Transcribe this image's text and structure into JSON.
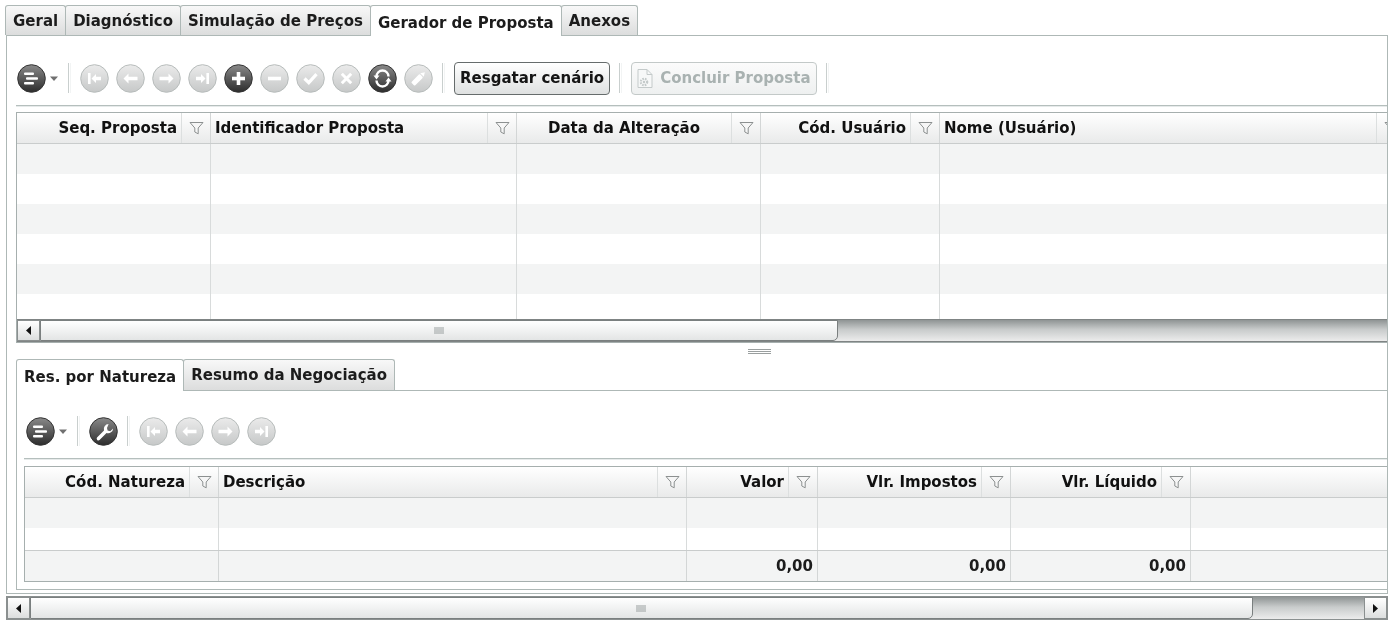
{
  "tabs": [
    {
      "label": "Geral",
      "selected": false
    },
    {
      "label": "Diagnóstico",
      "selected": false
    },
    {
      "label": "Simulação de Preços",
      "selected": false
    },
    {
      "label": "Gerador de Proposta",
      "selected": true
    },
    {
      "label": "Anexos",
      "selected": false
    }
  ],
  "toolbar": {
    "items": [
      {
        "kind": "menu",
        "disabled": false
      },
      {
        "kind": "separator"
      },
      {
        "kind": "first",
        "disabled": true
      },
      {
        "kind": "previous",
        "disabled": true
      },
      {
        "kind": "next",
        "disabled": true
      },
      {
        "kind": "last",
        "disabled": true
      },
      {
        "kind": "add",
        "disabled": false
      },
      {
        "kind": "remove",
        "disabled": true
      },
      {
        "kind": "confirm",
        "disabled": true
      },
      {
        "kind": "cancel",
        "disabled": true
      },
      {
        "kind": "refresh",
        "disabled": false
      },
      {
        "kind": "edit",
        "disabled": true
      },
      {
        "kind": "separator"
      },
      {
        "kind": "button",
        "label": "Resgatar cenário",
        "disabled": false
      },
      {
        "kind": "separator"
      },
      {
        "kind": "icon_button",
        "label": "Concluir Proposta",
        "disabled": true
      },
      {
        "kind": "separator"
      }
    ]
  },
  "proposals_table": {
    "columns": [
      {
        "label": "Seq. Proposta",
        "kind": "number"
      },
      {
        "label": "Identificador Proposta",
        "kind": "text"
      },
      {
        "label": "Data da Alteração",
        "kind": "date"
      },
      {
        "label": "Cód. Usuário",
        "kind": "number"
      },
      {
        "label": "Nome (Usuário)",
        "kind": "text"
      }
    ]
  },
  "detail_tabs": [
    {
      "label": "Res. por Natureza",
      "selected": true
    },
    {
      "label": "Resumo da Negociação",
      "selected": false
    }
  ],
  "detail_toolbar": {
    "items": [
      {
        "kind": "menu",
        "disabled": false
      },
      {
        "kind": "separator"
      },
      {
        "kind": "tools",
        "disabled": false
      },
      {
        "kind": "separator"
      },
      {
        "kind": "first",
        "disabled": true
      },
      {
        "kind": "previous",
        "disabled": true
      },
      {
        "kind": "next",
        "disabled": true
      },
      {
        "kind": "last",
        "disabled": true
      }
    ]
  },
  "nature_table": {
    "columns": [
      {
        "label": "Cód. Natureza",
        "kind": "number"
      },
      {
        "label": "Descrição",
        "kind": "text"
      },
      {
        "label": "Valor",
        "kind": "number",
        "total": "0,00"
      },
      {
        "label": "Vlr. Impostos",
        "kind": "number",
        "total": "0,00"
      },
      {
        "label": "Vlr. Líquido",
        "kind": "number",
        "total": "0,00"
      }
    ]
  }
}
